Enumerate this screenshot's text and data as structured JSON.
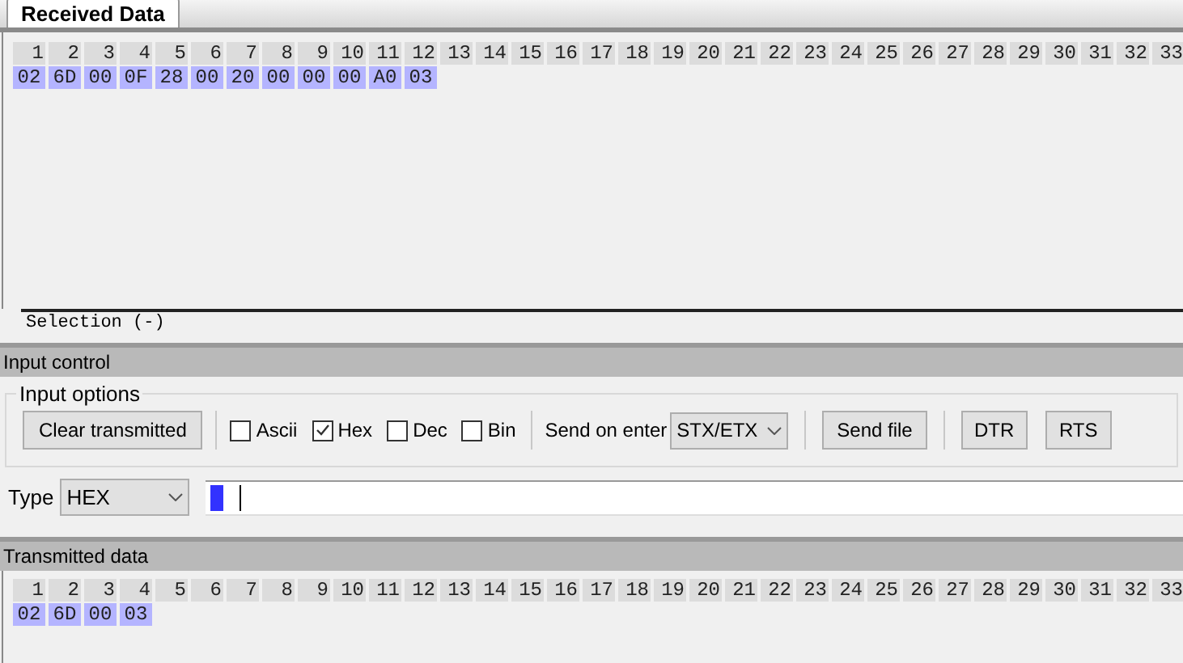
{
  "tabs": [
    {
      "label": "Received Data",
      "selected": true
    }
  ],
  "received": {
    "columns": [
      "1",
      "2",
      "3",
      "4",
      "5",
      "6",
      "7",
      "8",
      "9",
      "10",
      "11",
      "12",
      "13",
      "14",
      "15",
      "16",
      "17",
      "18",
      "19",
      "20",
      "21",
      "22",
      "23",
      "24",
      "25",
      "26",
      "27",
      "28",
      "29",
      "30",
      "31",
      "32",
      "33"
    ],
    "bytes": [
      "02",
      "6D",
      "00",
      "0F",
      "28",
      "00",
      "20",
      "00",
      "00",
      "00",
      "A0",
      "03"
    ]
  },
  "selection_label": "Selection (-)",
  "input_control": {
    "title": "Input control",
    "group_title": "Input options",
    "clear_button": "Clear transmitted",
    "formats": [
      {
        "label": "Ascii",
        "checked": false
      },
      {
        "label": "Hex",
        "checked": true
      },
      {
        "label": "Dec",
        "checked": false
      },
      {
        "label": "Bin",
        "checked": false
      }
    ],
    "send_on_enter": {
      "label": "Send on enter",
      "value": "STX/ETX"
    },
    "send_file_button": "Send file",
    "line_buttons": [
      "DTR",
      "RTS"
    ],
    "type": {
      "label": "Type",
      "value": "HEX"
    }
  },
  "transmitted": {
    "title": "Transmitted data",
    "columns": [
      "1",
      "2",
      "3",
      "4",
      "5",
      "6",
      "7",
      "8",
      "9",
      "10",
      "11",
      "12",
      "13",
      "14",
      "15",
      "16",
      "17",
      "18",
      "19",
      "20",
      "21",
      "22",
      "23",
      "24",
      "25",
      "26",
      "27",
      "28",
      "29",
      "30",
      "31",
      "32",
      "33"
    ],
    "bytes": [
      "02",
      "6D",
      "00",
      "03"
    ]
  }
}
